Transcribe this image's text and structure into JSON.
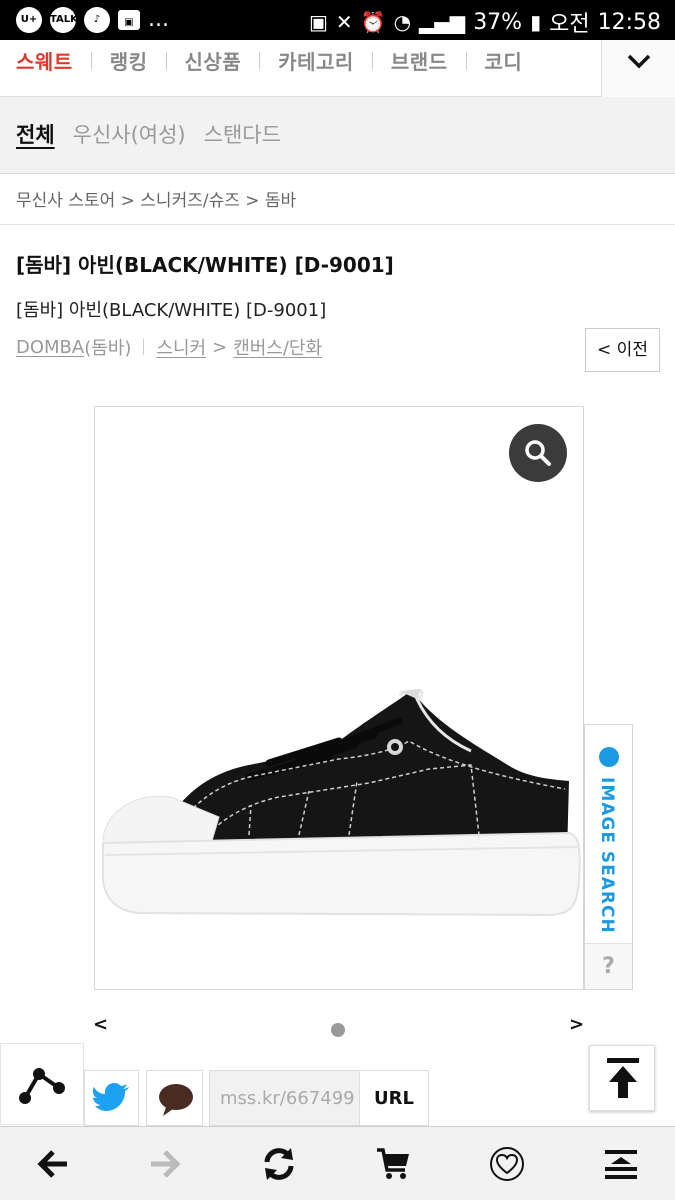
{
  "status_bar": {
    "left_icons": [
      "u-plus-icon",
      "kakaotalk-icon",
      "voice-icon",
      "gallery-icon"
    ],
    "more": "...",
    "battery": "37%",
    "ampm": "오전",
    "time": "12:58"
  },
  "top_nav": {
    "items": [
      "스웨트",
      "랭킹",
      "신상품",
      "카테고리",
      "브랜드",
      "코디"
    ],
    "active_color": "#e0392b"
  },
  "sub_tabs": [
    "전체",
    "우신사(여성)",
    "스탠다드"
  ],
  "breadcrumb": "무신사 스토어 > 스니커즈/슈즈 > 돔바",
  "product": {
    "title": "[돔바] 아빈(BLACK/WHITE) [D-9001]",
    "subtitle": "[돔바] 아빈(BLACK/WHITE) [D-9001]",
    "brand_en": "DOMBA",
    "brand_ko": "(돔바)",
    "category_1": "스니커",
    "category_sep": ">",
    "category_2": "캔버스/단화",
    "prev_label": "< 이전"
  },
  "image_search": {
    "label": "IMAGE SEARCH",
    "help": "?",
    "accent": "#1a9ae0"
  },
  "carousel": {
    "prev": "<",
    "next": ">"
  },
  "share": {
    "short_url": "mss.kr/667499",
    "url_button": "URL"
  },
  "browser_bar": [
    "back-arrow-icon",
    "forward-arrow-icon",
    "refresh-icon",
    "cart-icon",
    "heart-icon",
    "menu-icon"
  ]
}
